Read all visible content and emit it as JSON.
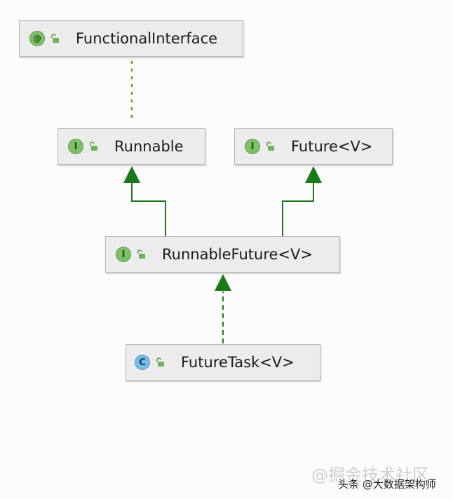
{
  "diagram": {
    "nodes": {
      "functional_interface": {
        "badge": "@",
        "label": "FunctionalInterface"
      },
      "runnable": {
        "badge": "I",
        "label": "Runnable"
      },
      "future": {
        "badge": "I",
        "label": "Future<V>"
      },
      "runnable_future": {
        "badge": "I",
        "label": "RunnableFuture<V>"
      },
      "future_task": {
        "badge": "C",
        "label": "FutureTask<V>"
      }
    },
    "edges": [
      {
        "from": "Runnable",
        "to": "FunctionalInterface",
        "style": "dotted"
      },
      {
        "from": "RunnableFuture<V>",
        "to": "Runnable",
        "style": "solid-extends"
      },
      {
        "from": "RunnableFuture<V>",
        "to": "Future<V>",
        "style": "solid-extends"
      },
      {
        "from": "FutureTask<V>",
        "to": "RunnableFuture<V>",
        "style": "dashed-implements"
      }
    ]
  },
  "watermark": {
    "logo_text": "@掘金技术社区",
    "credit": "头条 @大数据架构师"
  },
  "colors": {
    "edge_green": "#1a7a1a",
    "dotted_olive": "#8a8a2a",
    "interface_badge": "#7cc168",
    "class_badge": "#76b9e6",
    "node_background": "#ececec"
  }
}
